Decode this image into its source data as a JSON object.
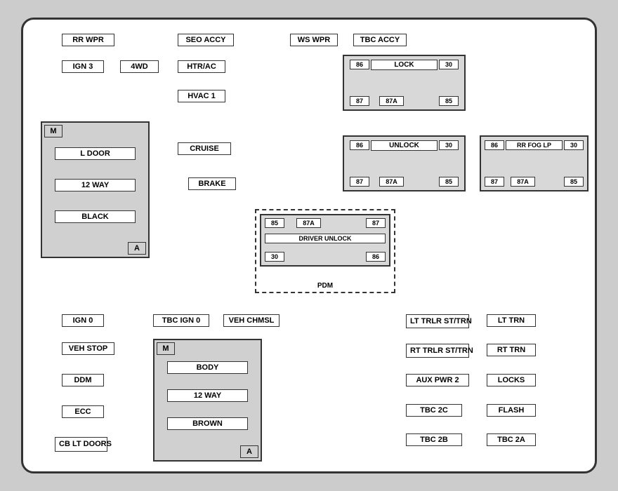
{
  "labels": {
    "rr_wpr": "RR WPR",
    "seo_accy": "SEO ACCY",
    "ws_wpr": "WS WPR",
    "tbc_accy": "TBC ACCY",
    "ign3": "IGN 3",
    "fwd": "4WD",
    "htr_ac": "HTR/AC",
    "hvac1": "HVAC 1",
    "cruise": "CRUISE",
    "brake": "BRAKE",
    "ign0": "IGN 0",
    "tbc_ign0": "TBC IGN 0",
    "veh_chmsl": "VEH CHMSL",
    "veh_stop": "VEH STOP",
    "ddm": "DDM",
    "ecc": "ECC",
    "cb_lt_doors": "CB\nLT DOORS",
    "lt_trlr": "LT TRLR\nST/TRN",
    "lt_trn": "LT TRN",
    "rt_trlr": "RT TRLR\nST/TRN",
    "rt_trn": "RT TRN",
    "aux_pwr2": "AUX PWR 2",
    "locks": "LOCKS",
    "tbc_2c": "TBC 2C",
    "flash": "FLASH",
    "tbc_2b": "TBC 2B",
    "tbc_2a": "TBC 2A",
    "pdm": "PDM"
  },
  "connectors": {
    "left": {
      "title": "L DOOR",
      "way": "12 WAY",
      "color": "BLACK",
      "m": "M",
      "a": "A"
    },
    "right_bottom": {
      "title": "BODY",
      "way": "12 WAY",
      "color": "BROWN",
      "m": "M",
      "a": "A"
    }
  },
  "relays": {
    "lock": {
      "name": "LOCK",
      "t86": "86",
      "t30": "30",
      "t87": "87",
      "t87a": "87A",
      "t85": "85"
    },
    "unlock": {
      "name": "UNLOCK",
      "t86": "86",
      "t30": "30",
      "t87": "87",
      "t87a": "87A",
      "t85": "85"
    },
    "rr_fog": {
      "name": "RR FOG LP",
      "t86": "86",
      "t30": "30",
      "t87": "87",
      "t87a": "87A",
      "t85": "85"
    },
    "driver_unlock": {
      "name": "DRIVER UNLOCK",
      "t85": "85",
      "t87a": "87A",
      "t87": "87",
      "t30": "30",
      "t86": "86"
    }
  }
}
